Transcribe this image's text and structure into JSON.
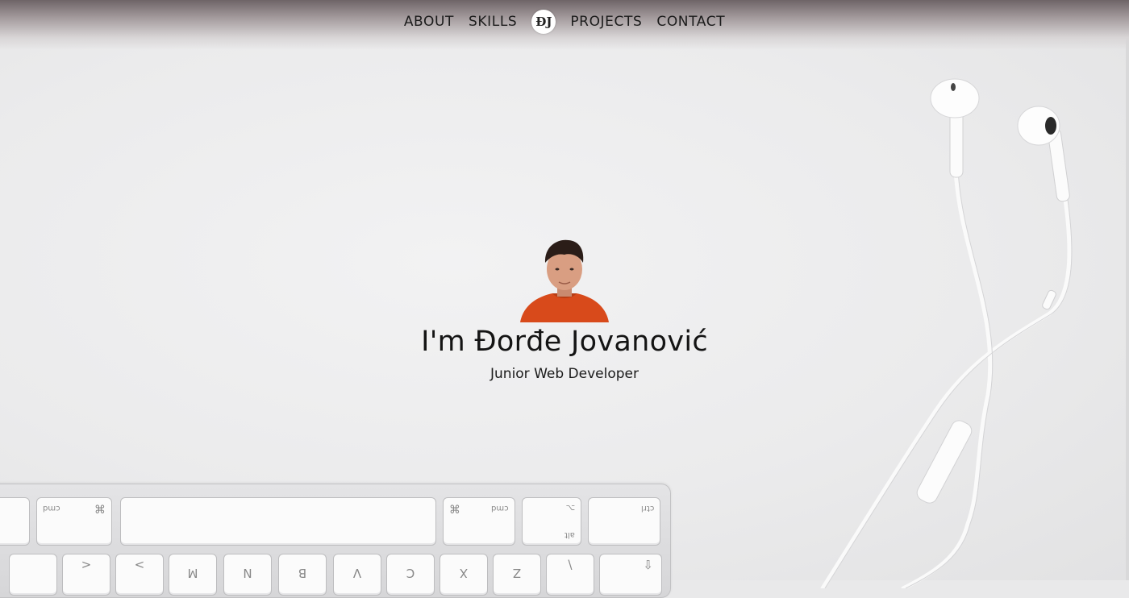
{
  "nav": {
    "items_left": [
      "ABOUT",
      "SKILLS"
    ],
    "logo": "ĐJ",
    "items_right": [
      "PROJECTS",
      "CONTACT"
    ]
  },
  "hero": {
    "title": "I'm Đorđe Jovanović",
    "subtitle": "Junior Web Developer",
    "avatar_icon": "person-portrait"
  },
  "decor": {
    "keyboard_icon": "keyboard-image",
    "earphones_icon": "earphones-image",
    "keycaps": {
      "cmd_left": "cmd",
      "cmd_symbol": "⌘",
      "cmd_right": "cmd",
      "opt": "opt",
      "alt": "alt",
      "ctrl": "ctrl"
    }
  },
  "colors": {
    "background": "#e9e9ea",
    "nav_top": "#6e6467",
    "shirt": "#d84a1b"
  }
}
